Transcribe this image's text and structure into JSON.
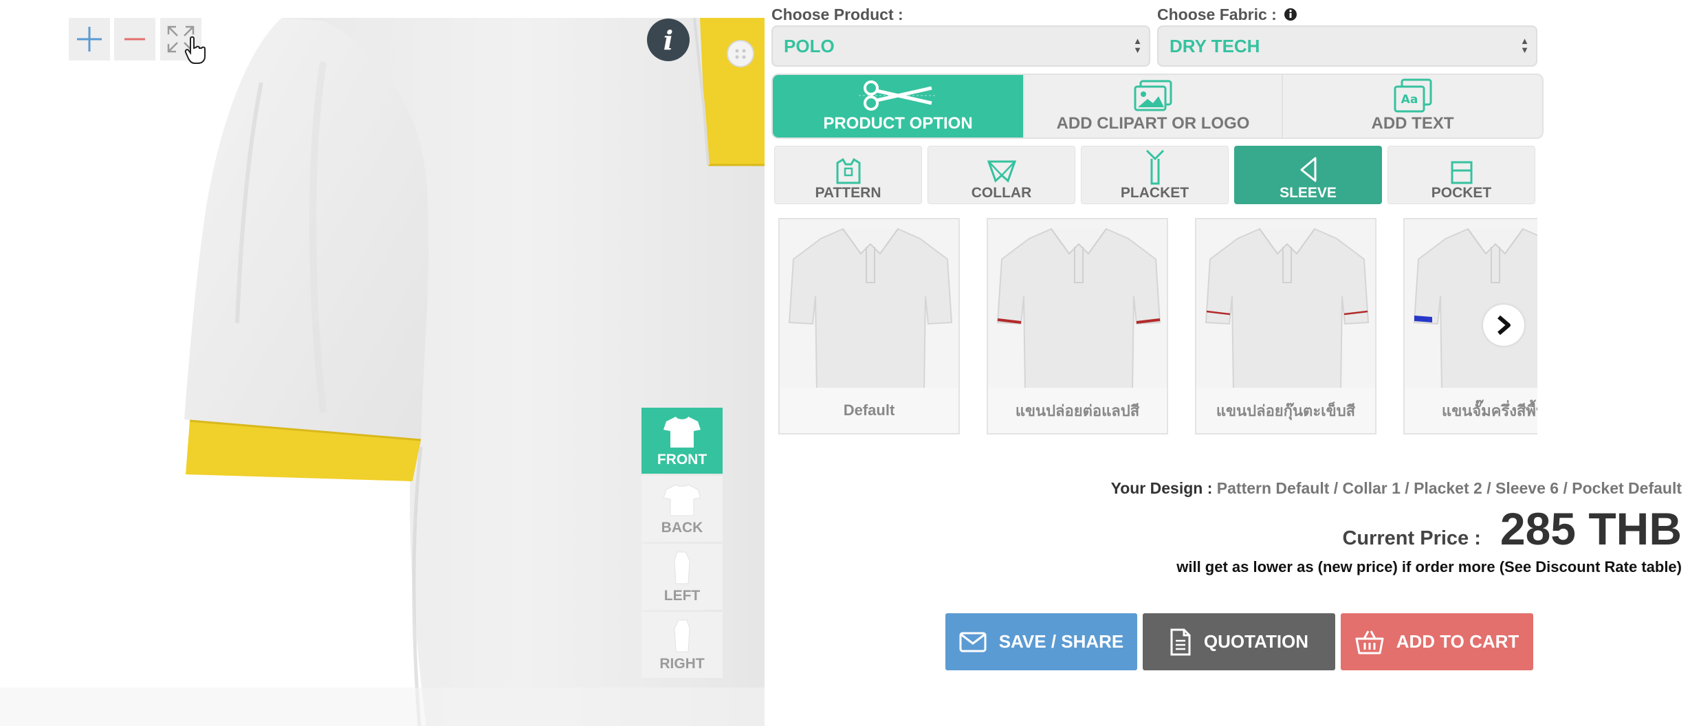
{
  "preview": {
    "info_symbol": "i",
    "views": [
      {
        "label": "FRONT",
        "active": true
      },
      {
        "label": "BACK",
        "active": false
      },
      {
        "label": "LEFT",
        "active": false
      },
      {
        "label": "RIGHT",
        "active": false
      }
    ],
    "shirt_body_color": "#efefef",
    "trim_color": "#f0d02a"
  },
  "product": {
    "label": "Choose Product :",
    "value": "POLO"
  },
  "fabric": {
    "label": "Choose Fabric :",
    "value": "DRY TECH"
  },
  "main_tabs": [
    {
      "label": "PRODUCT OPTION",
      "active": true,
      "icon": "scissors-icon"
    },
    {
      "label": "ADD CLIPART OR LOGO",
      "active": false,
      "icon": "image-icon"
    },
    {
      "label": "ADD TEXT",
      "active": false,
      "icon": "text-icon"
    }
  ],
  "sub_tabs": [
    {
      "label": "PATTERN",
      "active": false
    },
    {
      "label": "COLLAR",
      "active": false
    },
    {
      "label": "PLACKET",
      "active": false
    },
    {
      "label": "SLEEVE",
      "active": true
    },
    {
      "label": "POCKET",
      "active": false
    }
  ],
  "sleeve_options": [
    {
      "label": "Default"
    },
    {
      "label": "แขนปล่อยต่อแลปสี"
    },
    {
      "label": "แขนปล่อยกุ๊นตะเข็บสี"
    },
    {
      "label": "แขนจั๊มครึ่งสีพื้น"
    }
  ],
  "design": {
    "label": "Your Design :",
    "value": "Pattern Default / Collar 1 / Placket 2 / Sleeve 6 / Pocket Default"
  },
  "price": {
    "label": "Current Price :",
    "value": "285 THB",
    "note": "will get as lower as (new price) if order more (See Discount Rate table)"
  },
  "actions": {
    "save": "SAVE / SHARE",
    "quotation": "QUOTATION",
    "cart": "ADD TO CART"
  },
  "colors": {
    "accent": "#35c29f",
    "save": "#5b9bd3",
    "quotation": "#646464",
    "cart": "#e3706d"
  }
}
